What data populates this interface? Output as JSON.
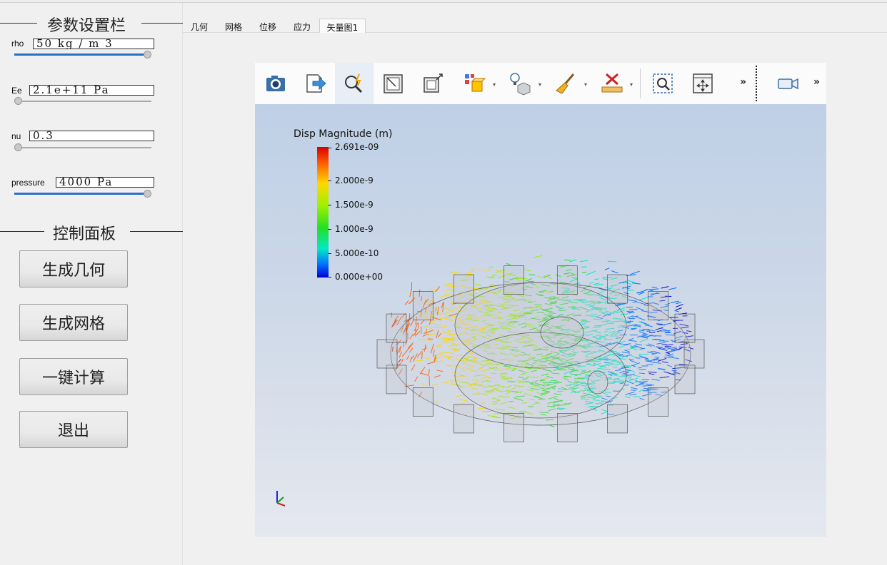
{
  "params_group": {
    "title": "参数设置栏",
    "params": [
      {
        "label": "rho",
        "value": "50 kg / m  3",
        "slider": 1.0
      },
      {
        "label": "Ee",
        "value": "2.1e+11 Pa",
        "slider": 0.0
      },
      {
        "label": "nu",
        "value": "0.3",
        "slider": 0.0
      },
      {
        "label": "pressure",
        "value": "4000 Pa",
        "slider": 1.0
      }
    ]
  },
  "control_group": {
    "title": "控制面板",
    "buttons": [
      "生成几何",
      "生成网格",
      "一键计算",
      "退出"
    ]
  },
  "tabs": [
    {
      "label": "几何",
      "active": false
    },
    {
      "label": "网格",
      "active": false
    },
    {
      "label": "位移",
      "active": false
    },
    {
      "label": "应力",
      "active": false
    },
    {
      "label": "矢量图1",
      "active": true
    }
  ],
  "toolbar": {
    "icons": [
      "camera-icon",
      "export-icon",
      "zoom-selection-icon",
      "reset-view-icon",
      "toggle-view-icon",
      "colored-cube-icon",
      "light-icon",
      "clear-brush-icon",
      "ruler-delete-icon",
      "zoom-box-icon",
      "fit-all-icon",
      "camera-record-icon"
    ],
    "more_label": "»"
  },
  "legend": {
    "title": "Disp Magnitude (m)",
    "labels": [
      "2.691e-09",
      "2.000e-9",
      "1.500e-9",
      "1.000e-9",
      "5.000e-10",
      "0.000e+00"
    ],
    "values": [
      2.691e-09,
      2e-09,
      1.5e-09,
      1e-09,
      5e-10,
      0.0
    ],
    "colors": [
      "#d40000",
      "#ff5a00",
      "#ffd800",
      "#9cf000",
      "#24e024",
      "#00e8c8",
      "#0070ff",
      "#0000d8"
    ]
  },
  "colors": {
    "panel_bg": "#f0f0f0",
    "scene_top": "#bfd0e6",
    "scene_bottom": "#e5e8ee",
    "slider_fill": "#2b6fc7"
  }
}
